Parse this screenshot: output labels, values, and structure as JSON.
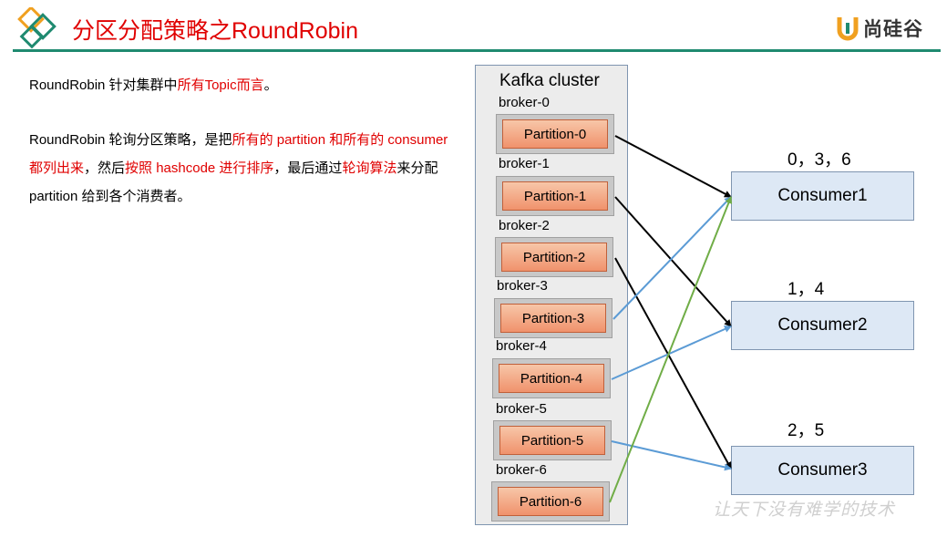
{
  "header": {
    "title": "分区分配策略之RoundRobin",
    "brand": "尚硅谷",
    "accent_color": "#e00000",
    "line_color": "#1f8a70"
  },
  "text": {
    "p1": [
      {
        "t": "RoundRobin 针对集群中",
        "red": false
      },
      {
        "t": "所有Topic而言",
        "red": true
      },
      {
        "t": "。",
        "red": false
      }
    ],
    "p2": [
      {
        "t": "RoundRobin 轮询分区策略，是把",
        "red": false
      },
      {
        "t": "所有的 partition 和所有的 consumer 都列出来",
        "red": true
      },
      {
        "t": "，然后",
        "red": false
      },
      {
        "t": "按照 hashcode 进行排序",
        "red": true
      },
      {
        "t": "，最后通过",
        "red": false
      },
      {
        "t": "轮询算法",
        "red": true
      },
      {
        "t": "来分配 partition 给到各个消费者。",
        "red": false
      }
    ]
  },
  "diagram": {
    "cluster_title": "Kafka cluster",
    "brokers": [
      "broker-0",
      "broker-1",
      "broker-2",
      "broker-3",
      "broker-4",
      "broker-5",
      "broker-6"
    ],
    "partitions": [
      "Partition-0",
      "Partition-1",
      "Partition-2",
      "Partition-3",
      "Partition-4",
      "Partition-5",
      "Partition-6"
    ],
    "consumers": [
      "Consumer1",
      "Consumer2",
      "Consumer3"
    ],
    "assignments": [
      "0，3，6",
      "1，4",
      "2，5"
    ],
    "edges": [
      {
        "from": 0,
        "to": 0,
        "color": "#000000"
      },
      {
        "from": 1,
        "to": 1,
        "color": "#000000"
      },
      {
        "from": 2,
        "to": 2,
        "color": "#000000"
      },
      {
        "from": 3,
        "to": 0,
        "color": "#5b9bd5"
      },
      {
        "from": 4,
        "to": 1,
        "color": "#5b9bd5"
      },
      {
        "from": 5,
        "to": 2,
        "color": "#5b9bd5"
      },
      {
        "from": 6,
        "to": 0,
        "color": "#70ad47"
      }
    ]
  },
  "watermark": "让天下没有难学的技术"
}
